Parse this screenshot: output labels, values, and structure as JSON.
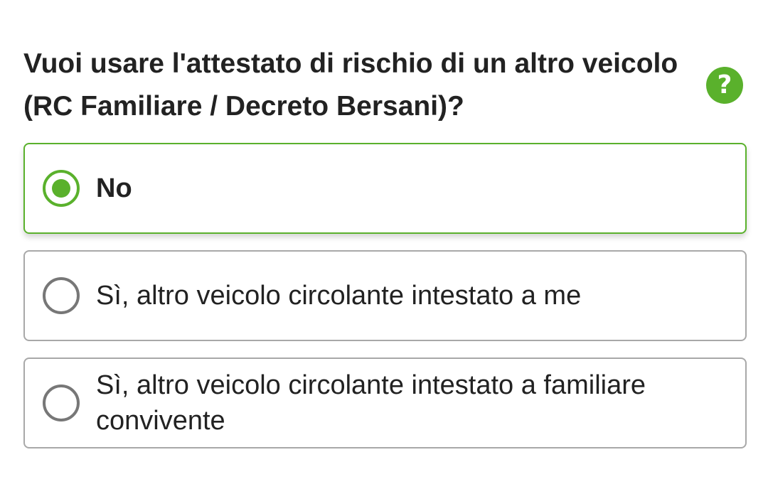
{
  "question": {
    "text": "Vuoi usare l'attestato di rischio di un altro veicolo (RC Familiare / Decreto Bersani)?",
    "help_icon": "question-mark-icon",
    "help_symbol": "?"
  },
  "options": [
    {
      "label": "No",
      "selected": true
    },
    {
      "label": "Sì, altro veicolo circolante intestato a me",
      "selected": false
    },
    {
      "label": "Sì, altro veicolo circolante intestato a familiare convivente",
      "selected": false
    }
  ],
  "colors": {
    "accent": "#5ab12c",
    "border": "#a8a8a8",
    "radio_unselected": "#777777",
    "text": "#222222"
  }
}
